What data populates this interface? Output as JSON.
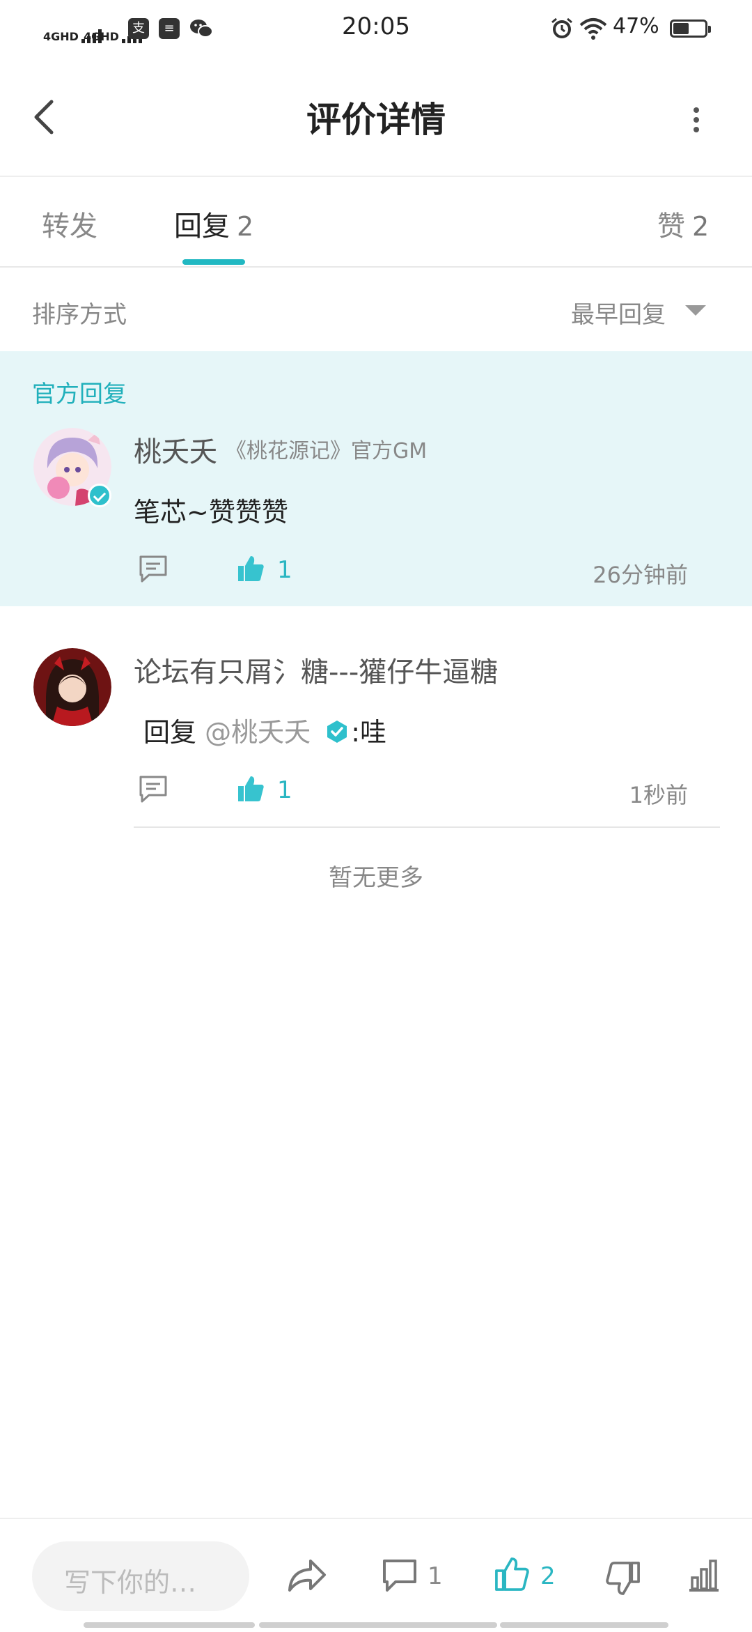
{
  "status_bar": {
    "time": "20:05",
    "battery": "47%",
    "network_1": "4GHD",
    "network_2": "4GHD",
    "app_icons": [
      "alipay-icon",
      "message-icon",
      "wechat-icon"
    ]
  },
  "header": {
    "title": "评价详情"
  },
  "tabs": {
    "forward": {
      "label": "转发"
    },
    "reply": {
      "label": "回复",
      "count": "2"
    },
    "like": {
      "label": "赞",
      "count": "2"
    }
  },
  "sort": {
    "label": "排序方式",
    "value": "最早回复"
  },
  "official": {
    "tag": "官方回复",
    "user": "桃夭夭",
    "sub": "《桃花源记》官方GM",
    "content": "笔芯~赞赞赞",
    "likes": "1",
    "time": "26分钟前"
  },
  "reply": {
    "user": "论坛有只屑氵糖---獾仔牛逼糖",
    "prefix": "回复",
    "mention": "@桃夭夭",
    "suffix": ":哇",
    "likes": "1",
    "time": "1秒前"
  },
  "footer_note": "暂无更多",
  "bottom_bar": {
    "placeholder": "写下你的…",
    "comments": "1",
    "likes": "2"
  },
  "colors": {
    "accent": "#21b8c2",
    "official_bg": "#e6f6f8"
  }
}
